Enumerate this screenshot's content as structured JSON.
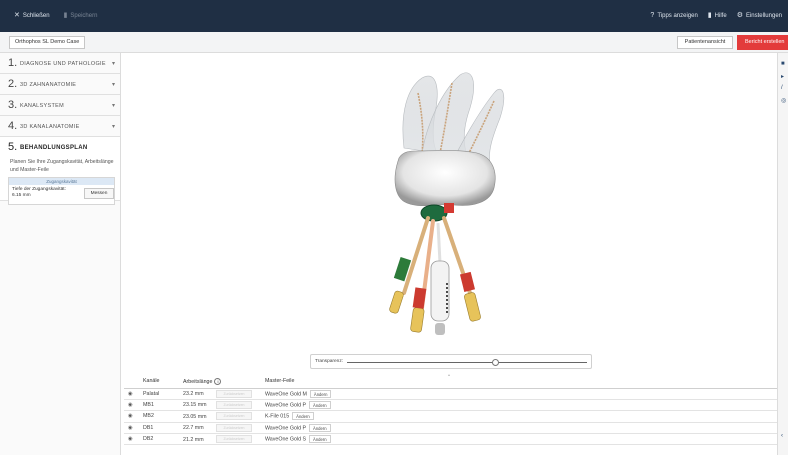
{
  "topbar": {
    "close_label": "Schließen",
    "save_label": "Speichern",
    "tips_label": "Tipps anzeigen",
    "help_label": "Hilfe",
    "settings_label": "Einstellungen"
  },
  "subbar": {
    "case_label": "Orthophos SL Demo Case",
    "patient_view_label": "Patientenansicht",
    "report_label": "Bericht erstellen"
  },
  "sidebar": {
    "steps": [
      {
        "num": "1.",
        "title": "DIAGNOSE UND PATHOLOGIE"
      },
      {
        "num": "2.",
        "title": "3D ZAHNANATOMIE"
      },
      {
        "num": "3.",
        "title": "KANALSYSTEM"
      },
      {
        "num": "4.",
        "title": "3D KANALANATOMIE"
      }
    ],
    "active": {
      "num": "5.",
      "title": "BEHANDLUNGSPLAN",
      "desc": "Planen Sie Ihre Zugangskavität, Arbeitslänge und Master-Feile"
    },
    "zugang": {
      "title": "Zugangskavität",
      "line1": "Tiefe der Zugangskavität:",
      "line2": "6.15 mm",
      "button": "Messen"
    }
  },
  "viewer": {
    "transparency_label": "Transparenz:",
    "transparency_level": 0.62
  },
  "table": {
    "headers": {
      "canal": "Kanäle",
      "length": "Arbeitslänge",
      "file": "Master-Feile"
    },
    "ghost_label": "Zurücksetzen",
    "change_label": "Ändern",
    "rows": [
      {
        "canal": "Palatal",
        "length": "23.2 mm",
        "file": "WaveOne Gold M"
      },
      {
        "canal": "MB1",
        "length": "23.15 mm",
        "file": "WaveOne Gold P"
      },
      {
        "canal": "MB2",
        "length": "23.05 mm",
        "file": "K-File 015"
      },
      {
        "canal": "DB1",
        "length": "22.7 mm",
        "file": "WaveOne Gold P"
      },
      {
        "canal": "DB2",
        "length": "21.2 mm",
        "file": "WaveOne Gold S"
      }
    ]
  },
  "colors": {
    "topbar_bg": "#1f2f44",
    "report_red": "#e33b3b",
    "accent_blue": "#2a4a70"
  }
}
